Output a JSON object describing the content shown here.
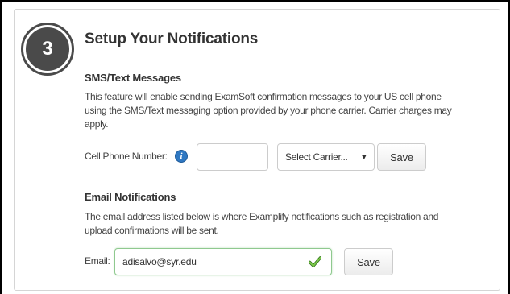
{
  "step": {
    "number": "3",
    "title": "Setup Your Notifications"
  },
  "sms": {
    "heading": "SMS/Text Messages",
    "description_lines": [
      "This feature will enable sending ExamSoft confirmation messages to your US cell phone",
      "using the SMS/Text messaging option provided by your phone carrier. Carrier charges may",
      "apply."
    ],
    "phone_label": "Cell Phone Number:",
    "phone_value": "",
    "phone_placeholder": "",
    "info_icon": "info-icon",
    "carrier_select": "Select Carrier...",
    "save_label": "Save"
  },
  "email": {
    "heading": "Email Notifications",
    "description_lines": [
      "The email address listed below is where Examplify notifications such as registration and",
      "upload confirmations will be sent."
    ],
    "email_label": "Email:",
    "email_value": "adisalvo@syr.edu",
    "valid_icon": "checkmark-icon",
    "save_label": "Save"
  },
  "colors": {
    "step_circle": "#4a4a4a",
    "info_icon": "#2f78c2",
    "valid_border": "#8fc98f",
    "valid_check": "#5aa832",
    "frame_border": "#000000"
  }
}
